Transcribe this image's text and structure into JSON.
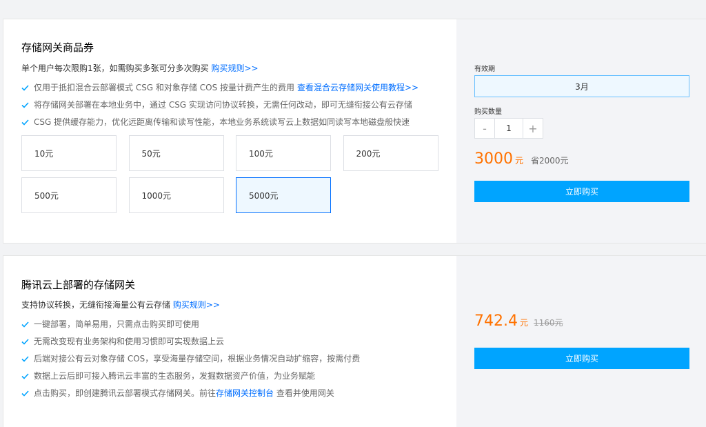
{
  "voucher": {
    "title": "存储网关商品券",
    "subtitle": "单个用户每次限购1张，如需购买多张可分多次购买",
    "rules_link": "购买规则>>",
    "features": [
      {
        "text": "仅用于抵扣混合云部署模式 CSG 和对象存储 COS 按量计费产生的费用",
        "link": "查看混合云存储网关使用教程>>"
      },
      {
        "text": "将存储网关部署在本地业务中，通过 CSG 实现访问协议转换，无需任何改动，即可无缝衔接公有云存储",
        "link": ""
      },
      {
        "text": "CSG 提供缓存能力，优化远距离传输和读写性能，本地业务系统读写云上数据如同读写本地磁盘般快速",
        "link": ""
      }
    ],
    "amounts": [
      "10元",
      "50元",
      "100元",
      "200元",
      "500元",
      "1000元",
      "5000元"
    ],
    "selected_amount": "5000元",
    "validity_label": "有效期",
    "validity_value": "3月",
    "quantity_label": "购买数量",
    "quantity_minus": "-",
    "quantity_value": "1",
    "quantity_plus": "+",
    "price": "3000",
    "price_unit": "元",
    "savings": "省2000元",
    "buy_label": "立即购买"
  },
  "cloud_gateway": {
    "title": "腾讯云上部署的存储网关",
    "subtitle": "支持协议转换，无缝衔接海量公有云存储",
    "rules_link": "购买规则>>",
    "features": [
      {
        "before": "一键部署，简单易用，只需点击购买即可使用",
        "link": "",
        "after": ""
      },
      {
        "before": "无需改变现有业务架构和使用习惯即可实现数据上云",
        "link": "",
        "after": ""
      },
      {
        "before": "后端对接公有云对象存储 COS，享受海量存储空间，根据业务情况自动扩缩容，按需付费",
        "link": "",
        "after": ""
      },
      {
        "before": "数据上云后即可接入腾讯云丰富的生态服务，发掘数据资产价值，为业务赋能",
        "link": "",
        "after": ""
      },
      {
        "before": "点击购买，即创建腾讯云部署模式存储网关。前往 ",
        "link": "存储网关控制台",
        "after": " 查看并使用网关"
      }
    ],
    "price": "742.4",
    "price_unit": "元",
    "original_price": "1160元",
    "buy_label": "立即购买"
  },
  "colors": {
    "accent": "#006eff",
    "button": "#00a4ff",
    "price": "#ff7200",
    "check": "#00a4ff"
  },
  "icons": {
    "feature_bullet": "check-icon"
  }
}
